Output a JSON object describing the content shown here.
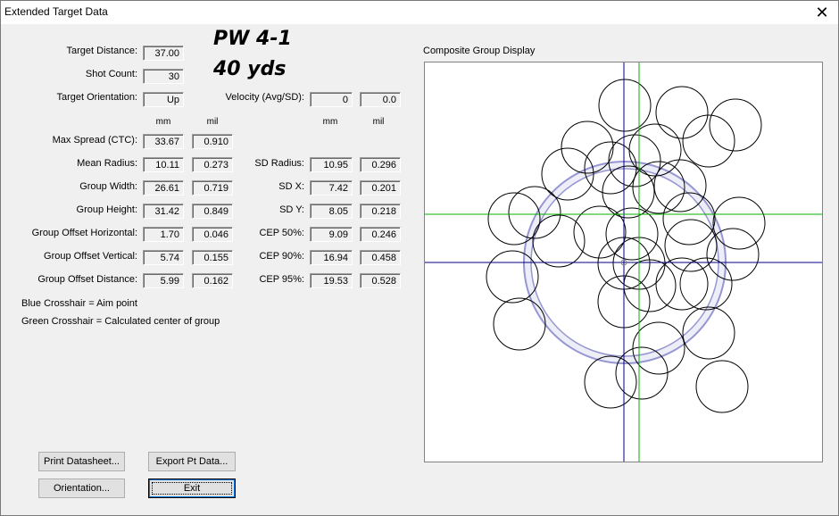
{
  "window": {
    "title": "Extended Target Data"
  },
  "stats_left": {
    "target_distance": {
      "label": "Target Distance:",
      "value": "37.00"
    },
    "shot_count": {
      "label": "Shot Count:",
      "value": "30"
    },
    "target_orientation": {
      "label": "Target Orientation:",
      "value": "Up"
    },
    "units": {
      "mm": "mm",
      "mil": "mil"
    },
    "rows": [
      {
        "label": "Max Spread (CTC):",
        "mm": "33.67",
        "mil": "0.910"
      },
      {
        "label": "Mean Radius:",
        "mm": "10.11",
        "mil": "0.273"
      },
      {
        "label": "Group Width:",
        "mm": "26.61",
        "mil": "0.719"
      },
      {
        "label": "Group Height:",
        "mm": "31.42",
        "mil": "0.849"
      },
      {
        "label": "Group Offset Horizontal:",
        "mm": "1.70",
        "mil": "0.046"
      },
      {
        "label": "Group Offset Vertical:",
        "mm": "5.74",
        "mil": "0.155"
      },
      {
        "label": "Group Offset Distance:",
        "mm": "5.99",
        "mil": "0.162"
      }
    ]
  },
  "heading": {
    "line1": "PW 4-1",
    "line2": "40 yds"
  },
  "velocity": {
    "label": "Velocity (Avg/SD):",
    "avg": "0",
    "sd": "0.0"
  },
  "stats_right": {
    "units": {
      "mm": "mm",
      "mil": "mil"
    },
    "rows": [
      {
        "label": "SD Radius:",
        "mm": "10.95",
        "mil": "0.296"
      },
      {
        "label": "SD X:",
        "mm": "7.42",
        "mil": "0.201"
      },
      {
        "label": "SD Y:",
        "mm": "8.05",
        "mil": "0.218"
      },
      {
        "label": "CEP 50%:",
        "mm": "9.09",
        "mil": "0.246"
      },
      {
        "label": "CEP 90%:",
        "mm": "16.94",
        "mil": "0.458"
      },
      {
        "label": "CEP 95%:",
        "mm": "19.53",
        "mil": "0.528"
      }
    ]
  },
  "legend": {
    "blue": "Blue Crosshair = Aim point",
    "green": "Green Crosshair = Calculated center of group"
  },
  "display": {
    "title": "Composite Group Display",
    "aim_color": "#000080",
    "center_color": "#00b000",
    "ring_color": "#9696d2",
    "ring_fill": "#eeeef8"
  },
  "buttons": {
    "print": "Print Datasheet...",
    "export": "Export Pt Data...",
    "orientation": "Orientation...",
    "exit": "Exit"
  }
}
